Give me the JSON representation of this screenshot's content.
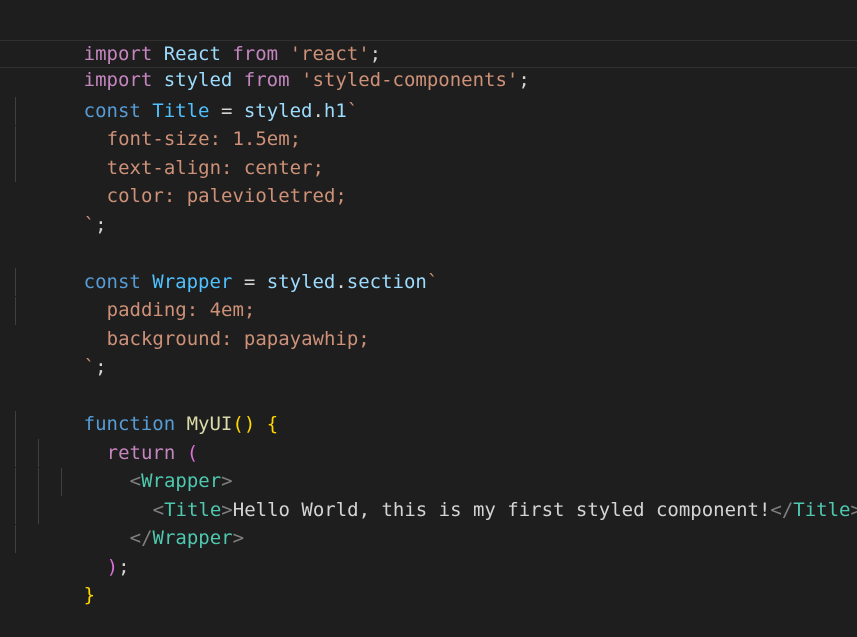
{
  "code": {
    "l1": {
      "t1": "import",
      "t2": " React ",
      "t3": "from",
      "t4": " ",
      "t5": "'react'",
      "t6": ";"
    },
    "l2": {
      "t1": "import",
      "t2": " styled ",
      "t3": "from",
      "t4": " ",
      "t5": "'styled-components'",
      "t6": ";"
    },
    "l3": {
      "t1": "const",
      "t2": " ",
      "t3": "Title",
      "t4": " = ",
      "t5": "styled",
      "t6": ".",
      "t7": "h1",
      "t8": "`"
    },
    "l4": {
      "t1": "font-size: 1.5em;"
    },
    "l5": {
      "t1": "text-align: center;"
    },
    "l6": {
      "t1": "color: palevioletred;"
    },
    "l7": {
      "t1": "`",
      "t2": ";"
    },
    "l9": {
      "t1": "const",
      "t2": " ",
      "t3": "Wrapper",
      "t4": " = ",
      "t5": "styled",
      "t6": ".",
      "t7": "section",
      "t8": "`"
    },
    "l10": {
      "t1": "padding: 4em;"
    },
    "l11": {
      "t1": "background: papayawhip;"
    },
    "l12": {
      "t1": "`",
      "t2": ";"
    },
    "l14": {
      "t1": "function",
      "t2": " ",
      "t3": "MyUI",
      "t4": "()",
      "t5": " ",
      "t6": "{"
    },
    "l15": {
      "t1": "return",
      "t2": " ",
      "t3": "("
    },
    "l16": {
      "t1": "<",
      "t2": "Wrapper",
      "t3": ">"
    },
    "l17": {
      "t1": "<",
      "t2": "Title",
      "t3": ">",
      "t4": "Hello World, this is my first styled component!",
      "t5": "</",
      "t6": "Title",
      "t7": ">"
    },
    "l18": {
      "t1": "</",
      "t2": "Wrapper",
      "t3": ">"
    },
    "l19": {
      "t1": ")",
      "t2": ";"
    },
    "l20": {
      "t1": "}"
    }
  }
}
